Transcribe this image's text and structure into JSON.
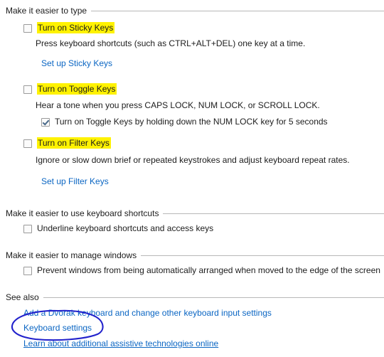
{
  "colors": {
    "highlight": "#fff200",
    "link": "#0b66c3",
    "ink_annotation": "#2222cc",
    "rule": "#b8b8b8",
    "text": "#1c1c1c"
  },
  "sections": {
    "type": {
      "header": "Make it easier to type",
      "sticky": {
        "label": "Turn on Sticky Keys",
        "checked": false,
        "highlighted": true,
        "description": "Press keyboard shortcuts (such as CTRL+ALT+DEL) one key at a time.",
        "link": "Set up Sticky Keys"
      },
      "toggle": {
        "label": "Turn on Toggle Keys",
        "checked": false,
        "highlighted": true,
        "description": "Hear a tone when you press CAPS LOCK, NUM LOCK, or SCROLL LOCK.",
        "sub_label": "Turn on Toggle Keys by holding down the NUM LOCK key for 5 seconds",
        "sub_checked": true
      },
      "filter": {
        "label": "Turn on Filter Keys",
        "checked": false,
        "highlighted": true,
        "description": "Ignore or slow down brief or repeated keystrokes and adjust keyboard repeat rates.",
        "link": "Set up Filter Keys"
      }
    },
    "shortcuts": {
      "header": "Make it easier to use keyboard shortcuts",
      "underline": {
        "label": "Underline keyboard shortcuts and access keys",
        "checked": false
      }
    },
    "windows": {
      "header": "Make it easier to manage windows",
      "prevent": {
        "label": "Prevent windows from being automatically arranged when moved to the edge of the screen",
        "checked": false
      }
    },
    "see_also": {
      "header": "See also",
      "links": [
        {
          "label": "Add a Dvorak keyboard and change other keyboard input settings",
          "underlined": false
        },
        {
          "label": "Keyboard settings",
          "underlined": false,
          "circled": true
        },
        {
          "label": "Learn about additional assistive technologies online",
          "underlined": true
        }
      ]
    }
  },
  "annotation": {
    "ellipse_target": "Keyboard settings",
    "ellipse_color": "#2222cc"
  }
}
